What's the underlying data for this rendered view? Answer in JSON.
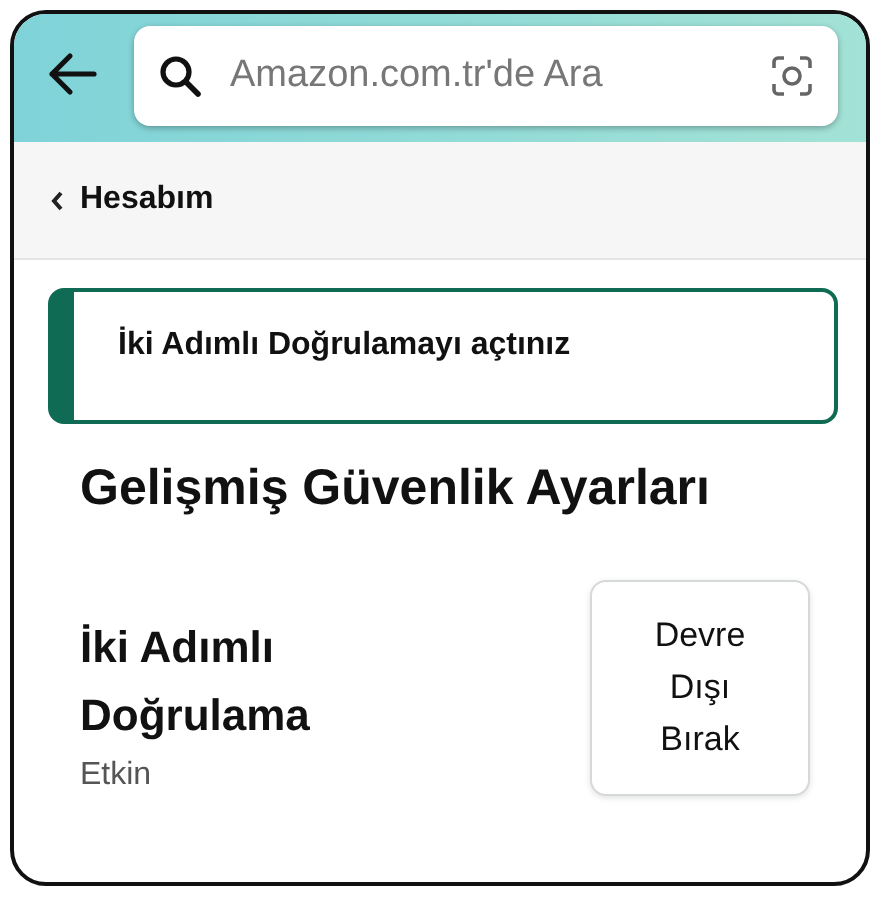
{
  "search": {
    "placeholder": "Amazon.com.tr'de Ara"
  },
  "breadcrumb": {
    "label": "Hesabım"
  },
  "alert": {
    "message": "İki Adımlı Doğrulamayı açtınız"
  },
  "page_title": "Gelişmiş Güvenlik Ayarları",
  "setting": {
    "title": "İki Adımlı Doğrulama",
    "status": "Etkin",
    "button": "Devre Dışı Bırak"
  }
}
